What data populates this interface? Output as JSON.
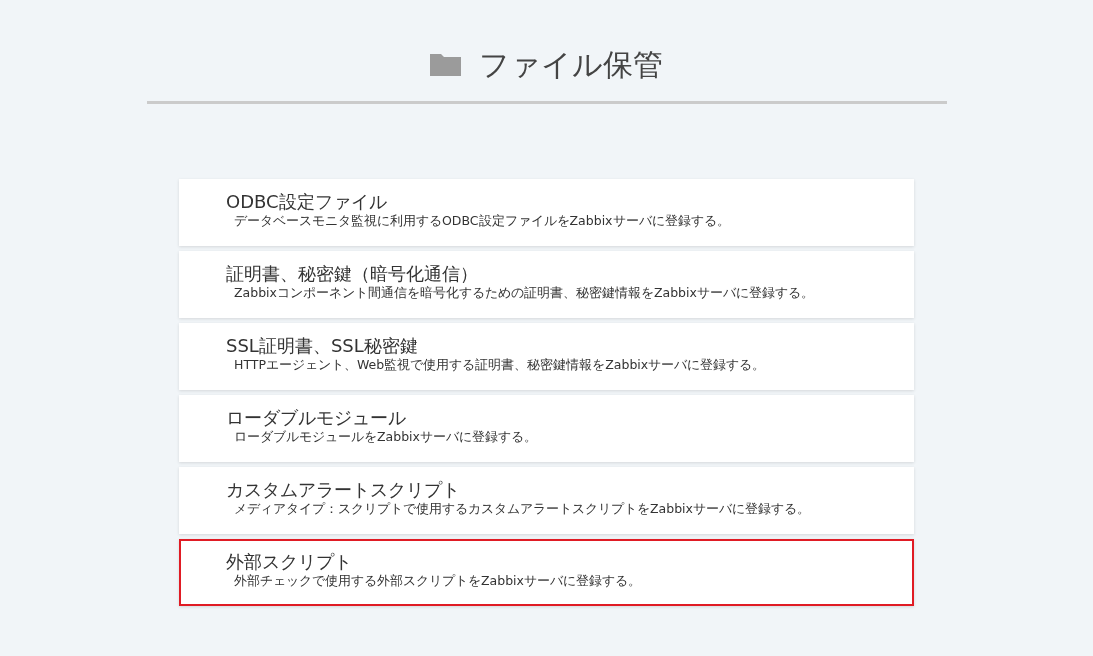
{
  "page": {
    "title": "ファイル保管"
  },
  "items": [
    {
      "title": "ODBC設定ファイル",
      "description": "データベースモニタ監視に利用するODBC設定ファイルをZabbixサーバに登録する。",
      "selected": false
    },
    {
      "title": "証明書、秘密鍵（暗号化通信）",
      "description": "Zabbixコンポーネント間通信を暗号化するための証明書、秘密鍵情報をZabbixサーバに登録する。",
      "selected": false
    },
    {
      "title": "SSL証明書、SSL秘密鍵",
      "description": "HTTPエージェント、Web監視で使用する証明書、秘密鍵情報をZabbixサーバに登録する。",
      "selected": false
    },
    {
      "title": "ローダブルモジュール",
      "description": "ローダブルモジュールをZabbixサーバに登録する。",
      "selected": false
    },
    {
      "title": "カスタムアラートスクリプト",
      "description": "メディアタイプ：スクリプトで使用するカスタムアラートスクリプトをZabbixサーバに登録する。",
      "selected": false
    },
    {
      "title": "外部スクリプト",
      "description": "外部チェックで使用する外部スクリプトをZabbixサーバに登録する。",
      "selected": true
    }
  ]
}
